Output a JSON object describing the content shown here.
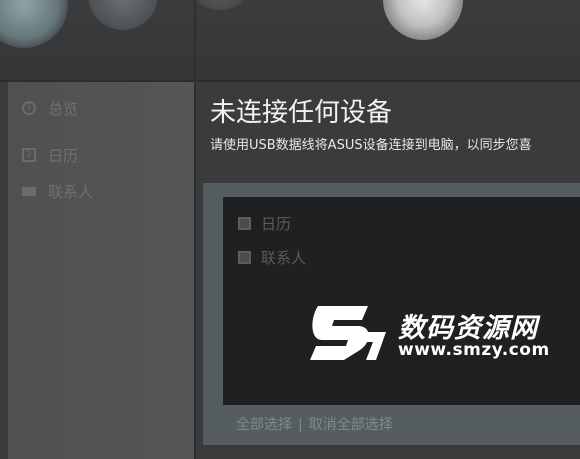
{
  "sidebar": {
    "items": [
      {
        "label": "总览",
        "icon": "overview-icon"
      },
      {
        "label": "日历",
        "icon": "calendar-icon"
      },
      {
        "label": "联系人",
        "icon": "contacts-icon"
      }
    ]
  },
  "main": {
    "title": "未连接任何设备",
    "subtitle": "请使用USB数据线将ASUS设备连接到电脑，以同步您喜"
  },
  "sync_panel": {
    "options": [
      {
        "label": "日历",
        "checked": false
      },
      {
        "label": "联系人",
        "checked": false
      }
    ],
    "select_all": "全部选择",
    "separator": "|",
    "deselect_all": "取消全部选择"
  },
  "watermark": {
    "brand": "数码资源网",
    "url": "www.smzy.com"
  },
  "colors": {
    "background": "#3a3b3c",
    "sidebar": "#525455",
    "panel": "#565d5f",
    "panel_inner": "#1f2021",
    "link": "#7e8a8d"
  }
}
